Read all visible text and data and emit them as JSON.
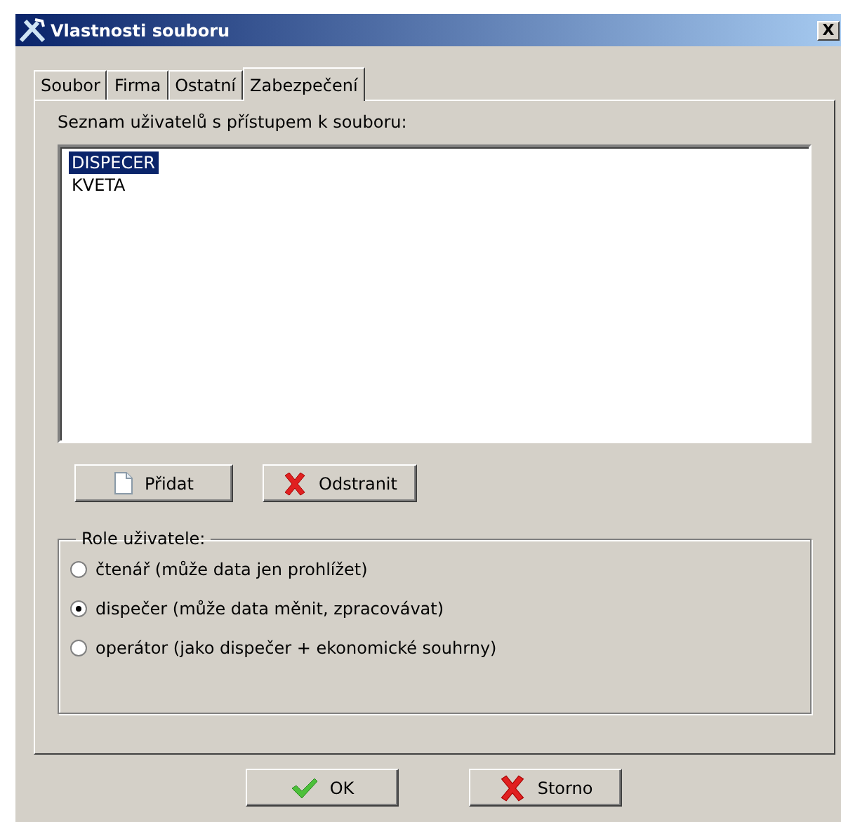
{
  "window": {
    "title": "Vlastnosti souboru",
    "close": "X"
  },
  "tabs": [
    {
      "label": "Soubor",
      "selected": false
    },
    {
      "label": "Firma",
      "selected": false
    },
    {
      "label": "Ostatní",
      "selected": false
    },
    {
      "label": "Zabezpečení",
      "selected": true
    }
  ],
  "users": {
    "label": "Seznam uživatelů s přístupem k souboru:",
    "items": [
      {
        "name": "DISPECER",
        "selected": true
      },
      {
        "name": "KVETA",
        "selected": false
      }
    ]
  },
  "user_buttons": [
    {
      "label": "Přidat",
      "kind": "add"
    },
    {
      "label": "Odstranit",
      "kind": "remove"
    }
  ],
  "role": {
    "legend": "Role uživatele:",
    "options": [
      {
        "label": "čtenář (může data jen prohlížet)",
        "selected": false
      },
      {
        "label": "dispečer (může data měnit, zpracovávat)",
        "selected": true
      },
      {
        "label": "operátor (jako dispečer + ekonomické souhrny)",
        "selected": false
      }
    ]
  },
  "buttons": [
    {
      "label": "OK",
      "kind": "ok"
    },
    {
      "label": "Storno",
      "kind": "cancel"
    }
  ]
}
